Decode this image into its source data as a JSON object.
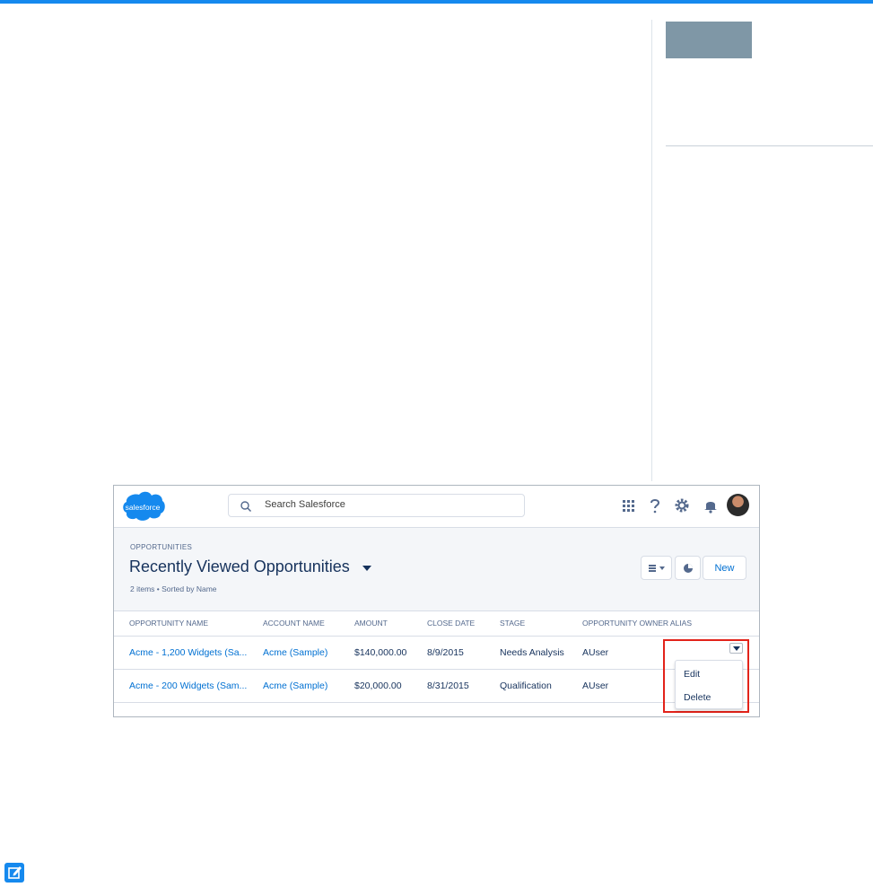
{
  "header": {
    "brand_label": "salesforce",
    "search_placeholder": "Search Salesforce",
    "icons": [
      "app-launcher-icon",
      "help-icon",
      "setup-gear-icon",
      "notifications-bell-icon",
      "avatar"
    ]
  },
  "list_view": {
    "object_label": "OPPORTUNITIES",
    "title": "Recently Viewed Opportunities",
    "meta": "2 items • Sorted by Name",
    "new_button": "New"
  },
  "table": {
    "columns": [
      "OPPORTUNITY NAME",
      "ACCOUNT NAME",
      "AMOUNT",
      "CLOSE DATE",
      "STAGE",
      "OPPORTUNITY OWNER ALIAS"
    ],
    "rows": [
      {
        "name": "Acme - 1,200 Widgets (Sa...",
        "account": "Acme (Sample)",
        "amount": "$140,000.00",
        "close_date": "8/9/2015",
        "stage": "Needs Analysis",
        "owner": "AUser"
      },
      {
        "name": "Acme - 200 Widgets (Sam...",
        "account": "Acme (Sample)",
        "amount": "$20,000.00",
        "close_date": "8/31/2015",
        "stage": "Qualification",
        "owner": "AUser"
      }
    ]
  },
  "row_menu": {
    "items": [
      "Edit",
      "Delete"
    ]
  },
  "colors": {
    "brand": "#1589ee",
    "link": "#0070d2",
    "highlight": "#e2231a",
    "text": "#16325c"
  }
}
